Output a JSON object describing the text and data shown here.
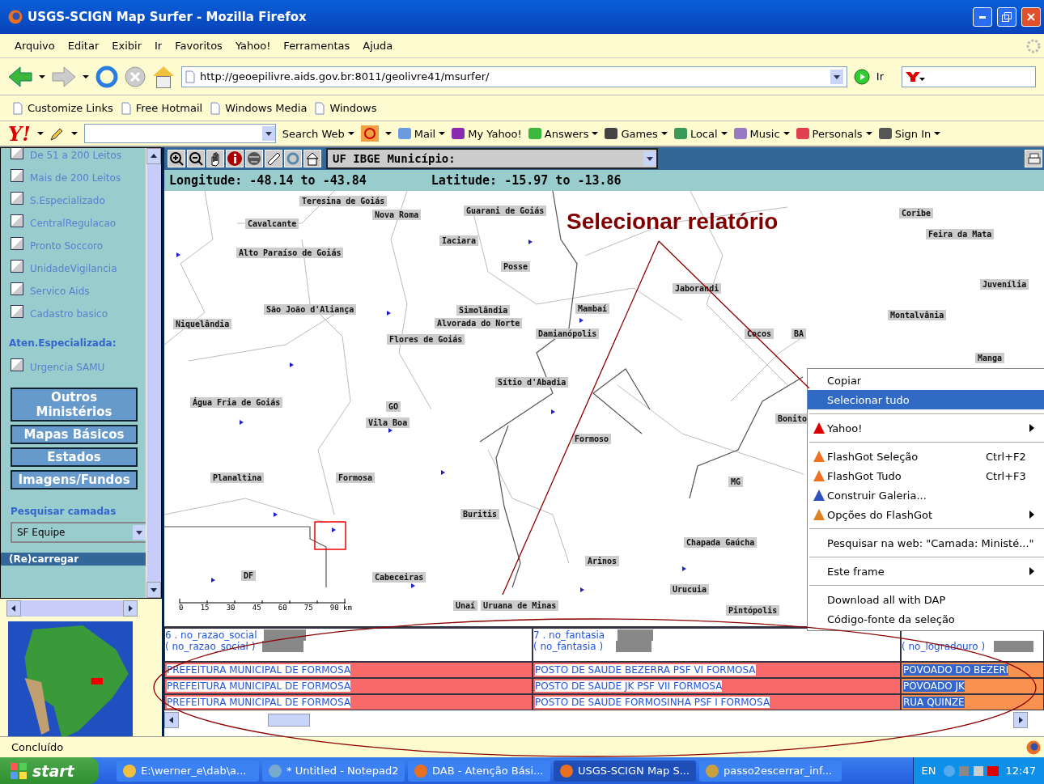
{
  "window": {
    "title": "USGS-SCIGN Map Surfer - Mozilla Firefox"
  },
  "menu_bar": [
    "Arquivo",
    "Editar",
    "Exibir",
    "Ir",
    "Favoritos",
    "Yahoo!",
    "Ferramentas",
    "Ajuda"
  ],
  "navigation": {
    "url": "http://geoepilivre.aids.gov.br:8011/geolivre41/msurfer/",
    "go_label": "Ir"
  },
  "bookmarks": [
    "Customize Links",
    "Free Hotmail",
    "Windows Media",
    "Windows"
  ],
  "yahoo_toolbar": {
    "logo": "Y!",
    "search_button": "Search Web",
    "items": [
      {
        "label": "Mail",
        "dropdown": true
      },
      {
        "label": "My Yahoo!",
        "dropdown": false
      },
      {
        "label": "Answers",
        "dropdown": true
      },
      {
        "label": "Games",
        "dropdown": true
      },
      {
        "label": "Local",
        "dropdown": true
      },
      {
        "label": "Music",
        "dropdown": true
      },
      {
        "label": "Personals",
        "dropdown": true
      },
      {
        "label": "Sign In",
        "dropdown": true
      }
    ]
  },
  "sidebar": {
    "layers": [
      {
        "label": "De 51 a 200 Leitos",
        "checked": false
      },
      {
        "label": "Mais de 200 Leitos",
        "checked": false
      },
      {
        "label": "S.Especializado",
        "checked": false
      },
      {
        "label": "CentralRegulacao",
        "checked": false
      },
      {
        "label": "Pronto Soccoro",
        "checked": false
      },
      {
        "label": "UnidadeVigilancia",
        "checked": false
      },
      {
        "label": "Servico Aids",
        "checked": false
      },
      {
        "label": "Cadastro basico",
        "checked": false
      }
    ],
    "section_heading": "Aten.Especializada:",
    "section_layers": [
      {
        "label": "Urgencia SAMU",
        "checked": false
      }
    ],
    "buttons": [
      "Outros Ministérios",
      "Mapas Básicos",
      "Estados",
      "Imagens/Fundos"
    ],
    "search_label": "Pesquisar camadas",
    "search_select": "SF Equipe",
    "reload_label": "(Re)carregar"
  },
  "map": {
    "layer_select": "UF IBGE Município:",
    "longitude": "Longitude: -48.14 to -43.84",
    "latitude": "Latitude: -15.97 to -13.86",
    "annotation": "Selecionar relatório",
    "places": [
      "Teresina de Goiás",
      "Cavalcante",
      "Nova Roma",
      "Guarani de Goiás",
      "Iaciara",
      "Alto Paraíso de Goiás",
      "Posse",
      "Jaborandi",
      "Coribe",
      "Feira da Mata",
      "Juvenília",
      "Montalvânia",
      "São João d'Aliança",
      "Niquelândia",
      "Simolândia",
      "Alvorada do Norte",
      "Mambaí",
      "Damianópolis",
      "Flores de Goiás",
      "Cocos",
      "BA",
      "Manga",
      "Sítio d'Abadia",
      "Água Fria de Goiás",
      "GO",
      "Vila Boa",
      "Formoso",
      "Bonito",
      "Planaltina",
      "Formosa",
      "MG",
      "Buritis",
      "Chapada Gaúcha",
      "Arinos",
      "DF",
      "Cabeceiras",
      "Unaí",
      "Uruana de Minas",
      "Urucuia",
      "Pintópolis"
    ],
    "scale_labels": [
      "0",
      "15",
      "30",
      "45",
      "60",
      "75",
      "90 km"
    ]
  },
  "table": {
    "columns": [
      {
        "title": "6 . no_razao_social",
        "field": "( no_razao_social )"
      },
      {
        "title": "7 . no_fantasia",
        "field": "( no_fantasia )"
      },
      {
        "field": "( no_logradouro )"
      }
    ],
    "rows": [
      [
        "PREFEITURA MUNICIPAL DE FORMOSA",
        "POSTO DE SAUDE BEZERRA PSF VI FORMOSA",
        "POVOADO DO BEZERI"
      ],
      [
        "PREFEITURA MUNICIPAL DE FORMOSA",
        "POSTO DE SAUDE JK PSF VII FORMOSA",
        "POVOADO JK"
      ],
      [
        "PREFEITURA MUNICIPAL DE FORMOSA",
        "POSTO DE SAUDE FORMOSINHA PSF I FORMOSA",
        "RUA QUINZE"
      ]
    ]
  },
  "context_menu": [
    {
      "kind": "item",
      "label": "Copiar",
      "selected": false
    },
    {
      "kind": "item",
      "label": "Selecionar tudo",
      "selected": true
    },
    {
      "kind": "separator"
    },
    {
      "kind": "submenu",
      "label": "Yahoo!",
      "selected": false
    },
    {
      "kind": "separator"
    },
    {
      "kind": "item",
      "label": "FlashGot Seleção",
      "shortcut": "Ctrl+F2",
      "selected": false
    },
    {
      "kind": "item",
      "label": "FlashGot Tudo",
      "shortcut": "Ctrl+F3",
      "selected": false
    },
    {
      "kind": "item",
      "label": "Construir Galeria...",
      "selected": false
    },
    {
      "kind": "submenu",
      "label": "Opções do FlashGot",
      "selected": false
    },
    {
      "kind": "separator"
    },
    {
      "kind": "item",
      "label": "Pesquisar na web: \"Camada: Ministé...\"",
      "selected": false
    },
    {
      "kind": "separator"
    },
    {
      "kind": "submenu",
      "label": "Este frame",
      "selected": false
    },
    {
      "kind": "separator"
    },
    {
      "kind": "item",
      "label": "Download all with DAP",
      "selected": false
    },
    {
      "kind": "item",
      "label": "Código-fonte da seleção",
      "selected": false
    }
  ],
  "status_bar": "Concluído",
  "taskbar": {
    "start": "start",
    "tasks": [
      {
        "label": "E:\\werner_e\\dab\\a...",
        "selected": false
      },
      {
        "label": "* Untitled - Notepad2",
        "selected": false
      },
      {
        "label": "DAB - Atenção Bási...",
        "selected": false
      },
      {
        "label": "USGS-SCIGN Map S...",
        "selected": true
      },
      {
        "label": "passo2escerrar_inf...",
        "selected": false
      }
    ],
    "language": "EN",
    "clock": "12:47"
  }
}
